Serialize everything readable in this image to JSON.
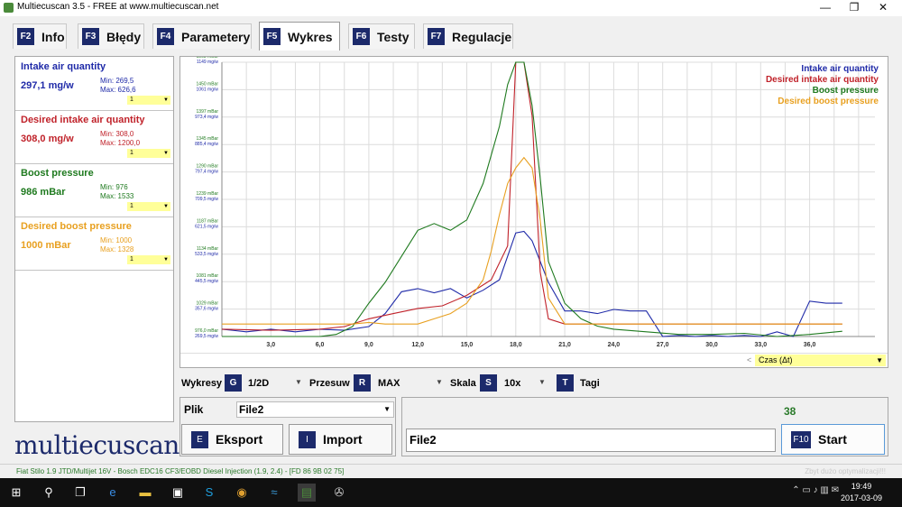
{
  "window": {
    "title": "Multiecuscan 3.5 - FREE at www.multiecuscan.net",
    "minimize": "—",
    "maximize": "❐",
    "close": "✕"
  },
  "tabs": [
    {
      "key": "F2",
      "label": "Info"
    },
    {
      "key": "F3",
      "label": "Błędy"
    },
    {
      "key": "F4",
      "label": "Parametery"
    },
    {
      "key": "F5",
      "label": "Wykres"
    },
    {
      "key": "F6",
      "label": "Testy"
    },
    {
      "key": "F7",
      "label": "Regulacje"
    }
  ],
  "params": [
    {
      "name": "Intake air quantity",
      "value": "297,1 mg/w",
      "min": "Min: 269,5",
      "max": "Max: 626,6",
      "scale": "1",
      "color": "#1f2aa8"
    },
    {
      "name": "Desired intake air quantity",
      "value": "308,0 mg/w",
      "min": "Min: 308,0",
      "max": "Max: 1200,0",
      "scale": "1",
      "color": "#c0222a"
    },
    {
      "name": "Boost pressure",
      "value": "986 mBar",
      "min": "Min: 976",
      "max": "Max: 1533",
      "scale": "1",
      "color": "#1f7a1f"
    },
    {
      "name": "Desired boost pressure",
      "value": "1000 mBar",
      "min": "Min: 1000",
      "max": "Max: 1328",
      "scale": "1",
      "color": "#e8a020"
    }
  ],
  "logo": "multiecuscan",
  "chart_data": {
    "type": "line",
    "xlabel": "Czas (Δt)",
    "x_ticks": [
      "3,0",
      "6,0",
      "9,0",
      "12,0",
      "15,0",
      "18,0",
      "21,0",
      "24,0",
      "27,0",
      "30,0",
      "33,0",
      "36,0"
    ],
    "y_ticks_pressure": [
      "976,0 mBar",
      "1029 mBar",
      "1081 mBar",
      "1134 mBar",
      "1187 mBar",
      "1239 mBar",
      "1290 mBar",
      "1345 mBar",
      "1397 mBar",
      "1450 mBar",
      "1503 mBar"
    ],
    "y_ticks_air": [
      "269,5 mg/w",
      "357,6 mg/w",
      "445,5 mg/w",
      "533,5 mg/w",
      "621,5 mg/w",
      "709,5 mg/w",
      "797,4 mg/w",
      "885,4 mg/w",
      "973,4 mg/w",
      "1061 mg/w",
      "1149 mg/w"
    ],
    "ylim_pressure": [
      976,
      1503
    ],
    "xlim": [
      0,
      40
    ],
    "grid": true,
    "legend_position": "top-right",
    "series": [
      {
        "name": "Intake air quantity",
        "color": "#1f2aa8",
        "x": [
          0,
          1.5,
          3,
          4.5,
          6,
          7.5,
          9,
          10,
          11,
          12,
          13,
          14,
          15,
          16,
          17,
          18,
          18.5,
          19,
          20,
          21,
          22,
          23,
          24,
          25,
          26,
          27,
          28,
          29,
          30,
          31,
          32,
          33,
          34,
          35,
          36,
          37,
          38
        ],
        "y": [
          990,
          985,
          990,
          985,
          990,
          988,
          995,
          1020,
          1062,
          1068,
          1060,
          1068,
          1050,
          1065,
          1085,
          1175,
          1178,
          1160,
          1080,
          1025,
          1025,
          1020,
          1028,
          1025,
          1025,
          976,
          978,
          976,
          978,
          976,
          978,
          976,
          985,
          976,
          1044,
          1040,
          1040
        ]
      },
      {
        "name": "Desired intake air quantity",
        "color": "#c0222a",
        "x": [
          0,
          3,
          6,
          7.5,
          9,
          10.5,
          12,
          13.5,
          15,
          16.5,
          17.5,
          18,
          18.5,
          19,
          19.5,
          20,
          21,
          22,
          24,
          27,
          30,
          33,
          36,
          38
        ],
        "y": [
          990,
          988,
          990,
          995,
          1010,
          1020,
          1030,
          1035,
          1055,
          1085,
          1150,
          1503,
          1503,
          1400,
          1100,
          1010,
          1000,
          1000,
          1000,
          1000,
          1000,
          1000,
          1000,
          1000
        ]
      },
      {
        "name": "Boost pressure",
        "color": "#1f7a1f",
        "x": [
          0,
          3,
          6,
          7,
          8,
          9,
          10,
          11,
          12,
          13,
          14,
          15,
          16,
          17,
          17.5,
          18,
          18.5,
          19,
          19.5,
          20,
          21,
          22,
          23,
          24,
          26,
          28,
          30,
          32,
          34,
          36,
          38
        ],
        "y": [
          976,
          976,
          976,
          980,
          995,
          1040,
          1080,
          1130,
          1180,
          1193,
          1180,
          1200,
          1270,
          1380,
          1460,
          1503,
          1503,
          1420,
          1280,
          1120,
          1040,
          1010,
          996,
          990,
          985,
          980,
          980,
          982,
          976,
          980,
          986
        ]
      },
      {
        "name": "Desired boost pressure",
        "color": "#e8a020",
        "x": [
          0,
          3,
          6,
          8,
          9,
          10,
          11,
          12,
          13,
          14,
          15,
          16,
          16.5,
          17,
          17.5,
          18,
          18.5,
          19,
          19.5,
          20,
          21,
          22,
          24,
          27,
          30,
          33,
          36,
          38
        ],
        "y": [
          1000,
          1000,
          1000,
          1000,
          1003,
          1000,
          1000,
          1000,
          1010,
          1020,
          1040,
          1085,
          1140,
          1210,
          1270,
          1300,
          1320,
          1300,
          1200,
          1050,
          1000,
          1000,
          1000,
          1000,
          1000,
          1000,
          1000,
          1000
        ]
      }
    ]
  },
  "controls": {
    "wykresy_label": "Wykresy",
    "wykresy_key": "G",
    "wykresy_value": "1/2D",
    "przesuw_label": "Przesuw",
    "przesuw_key": "R",
    "przesuw_value": "MAX",
    "skala_label": "Skala",
    "skala_key": "S",
    "skala_value": "10x",
    "tagi_key": "T",
    "tagi_label": "Tagi"
  },
  "file": {
    "label": "Plik",
    "selected": "File2",
    "export_key": "E",
    "export_label": "Eksport",
    "import_key": "I",
    "import_label": "Import"
  },
  "run": {
    "counter": "38",
    "name": "File2",
    "start_key": "F10",
    "start_label": "Start"
  },
  "status": {
    "vehicle": "Fiat Stilo 1.9 JTD/Multijet 16V - Bosch EDC16 CF3/EOBD Diesel Injection (1.9, 2.4) - [FD 86 9B 02 75]",
    "hint": "Zbyt dużo optymalizacji!!!"
  },
  "taskbar": {
    "time": "19:49",
    "date": "2017-03-09"
  }
}
